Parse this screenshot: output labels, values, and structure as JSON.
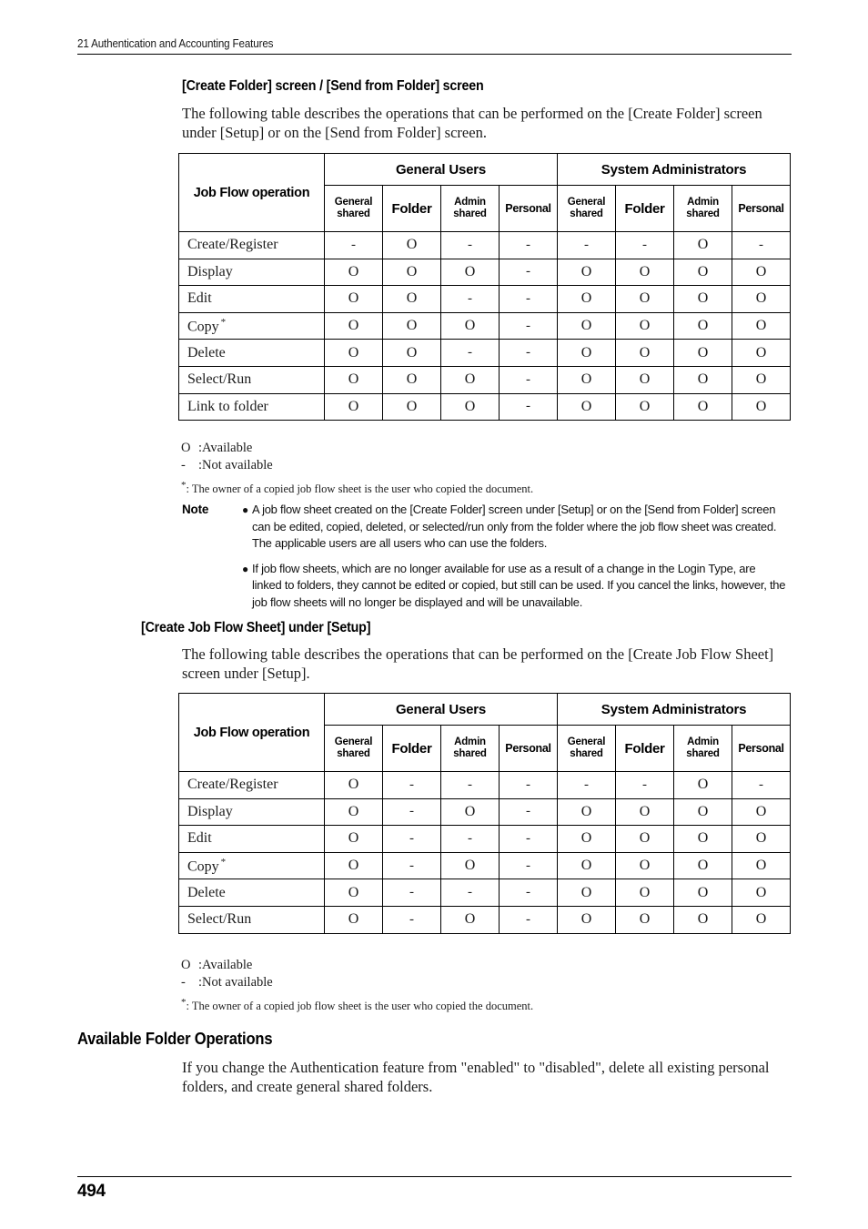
{
  "running_header": "21 Authentication and Accounting Features",
  "page_number": "494",
  "section1": {
    "heading": "[Create Folder] screen / [Send from Folder] screen",
    "intro": "The following table describes the operations that can be performed on the [Create Folder] screen under [Setup] or on the [Send from Folder] screen.",
    "table": {
      "row_header_label": "Job Flow operation",
      "group_headers": [
        "General Users",
        "System Administrators"
      ],
      "sub_headers": [
        {
          "line1": "General",
          "line2": "shared"
        },
        {
          "line1": "Folder",
          "line2": ""
        },
        {
          "line1": "Admin",
          "line2": "shared"
        },
        {
          "line1": "Personal",
          "line2": ""
        },
        {
          "line1": "General",
          "line2": "shared"
        },
        {
          "line1": "Folder",
          "line2": ""
        },
        {
          "line1": "Admin",
          "line2": "shared"
        },
        {
          "line1": "Personal",
          "line2": ""
        }
      ],
      "rows": [
        {
          "operation": "Create/Register",
          "starred": false,
          "values": [
            "-",
            "O",
            "-",
            "-",
            "-",
            "-",
            "O",
            "-"
          ]
        },
        {
          "operation": "Display",
          "starred": false,
          "values": [
            "O",
            "O",
            "O",
            "-",
            "O",
            "O",
            "O",
            "O"
          ]
        },
        {
          "operation": "Edit",
          "starred": false,
          "values": [
            "O",
            "O",
            "-",
            "-",
            "O",
            "O",
            "O",
            "O"
          ]
        },
        {
          "operation": "Copy",
          "starred": true,
          "values": [
            "O",
            "O",
            "O",
            "-",
            "O",
            "O",
            "O",
            "O"
          ]
        },
        {
          "operation": "Delete",
          "starred": false,
          "values": [
            "O",
            "O",
            "-",
            "-",
            "O",
            "O",
            "O",
            "O"
          ]
        },
        {
          "operation": "Select/Run",
          "starred": false,
          "values": [
            "O",
            "O",
            "O",
            "-",
            "O",
            "O",
            "O",
            "O"
          ]
        },
        {
          "operation": "Link to folder",
          "starred": false,
          "values": [
            "O",
            "O",
            "O",
            "-",
            "O",
            "O",
            "O",
            "O"
          ]
        }
      ]
    },
    "legend": [
      {
        "symbol": "O",
        "text": ":Available"
      },
      {
        "symbol": "-",
        "text": ":Not available"
      }
    ],
    "footnote": ": The owner of a copied job flow sheet is the user who copied the document.",
    "note_label": "Note",
    "notes": [
      "A job flow sheet created on the [Create Folder] screen under [Setup] or on the [Send from Folder] screen can be edited, copied, deleted, or selected/run only from the folder where the job flow sheet was created. The applicable users are all users who can use the folders.",
      "If job flow sheets, which are no longer available for use as a result of a change in the Login Type, are linked to folders, they cannot be edited or copied, but still can be used. If you cancel the links, however, the job flow sheets will no longer be displayed and will be unavailable."
    ]
  },
  "section2": {
    "heading": "[Create Job Flow Sheet] under [Setup]",
    "intro": "The following table describes the operations that can be performed on the [Create Job Flow Sheet] screen under [Setup].",
    "table": {
      "row_header_label": "Job Flow operation",
      "group_headers": [
        "General Users",
        "System Administrators"
      ],
      "sub_headers": [
        {
          "line1": "General",
          "line2": "shared"
        },
        {
          "line1": "Folder",
          "line2": ""
        },
        {
          "line1": "Admin",
          "line2": "shared"
        },
        {
          "line1": "Personal",
          "line2": ""
        },
        {
          "line1": "General",
          "line2": "shared"
        },
        {
          "line1": "Folder",
          "line2": ""
        },
        {
          "line1": "Admin",
          "line2": "shared"
        },
        {
          "line1": "Personal",
          "line2": ""
        }
      ],
      "rows": [
        {
          "operation": "Create/Register",
          "starred": false,
          "values": [
            "O",
            "-",
            "-",
            "-",
            "-",
            "-",
            "O",
            "-"
          ]
        },
        {
          "operation": "Display",
          "starred": false,
          "values": [
            "O",
            "-",
            "O",
            "-",
            "O",
            "O",
            "O",
            "O"
          ]
        },
        {
          "operation": "Edit",
          "starred": false,
          "values": [
            "O",
            "-",
            "-",
            "-",
            "O",
            "O",
            "O",
            "O"
          ]
        },
        {
          "operation": "Copy",
          "starred": true,
          "values": [
            "O",
            "-",
            "O",
            "-",
            "O",
            "O",
            "O",
            "O"
          ]
        },
        {
          "operation": "Delete",
          "starred": false,
          "values": [
            "O",
            "-",
            "-",
            "-",
            "O",
            "O",
            "O",
            "O"
          ]
        },
        {
          "operation": "Select/Run",
          "starred": false,
          "values": [
            "O",
            "-",
            "O",
            "-",
            "O",
            "O",
            "O",
            "O"
          ]
        }
      ]
    },
    "legend": [
      {
        "symbol": "O",
        "text": ":Available"
      },
      {
        "symbol": "-",
        "text": ":Not available"
      }
    ],
    "footnote": ": The owner of a copied job flow sheet is the user who copied the document."
  },
  "section3": {
    "heading": "Available Folder Operations",
    "body": "If you change the Authentication feature from \"enabled\" to \"disabled\", delete all existing personal folders, and create general shared folders."
  }
}
